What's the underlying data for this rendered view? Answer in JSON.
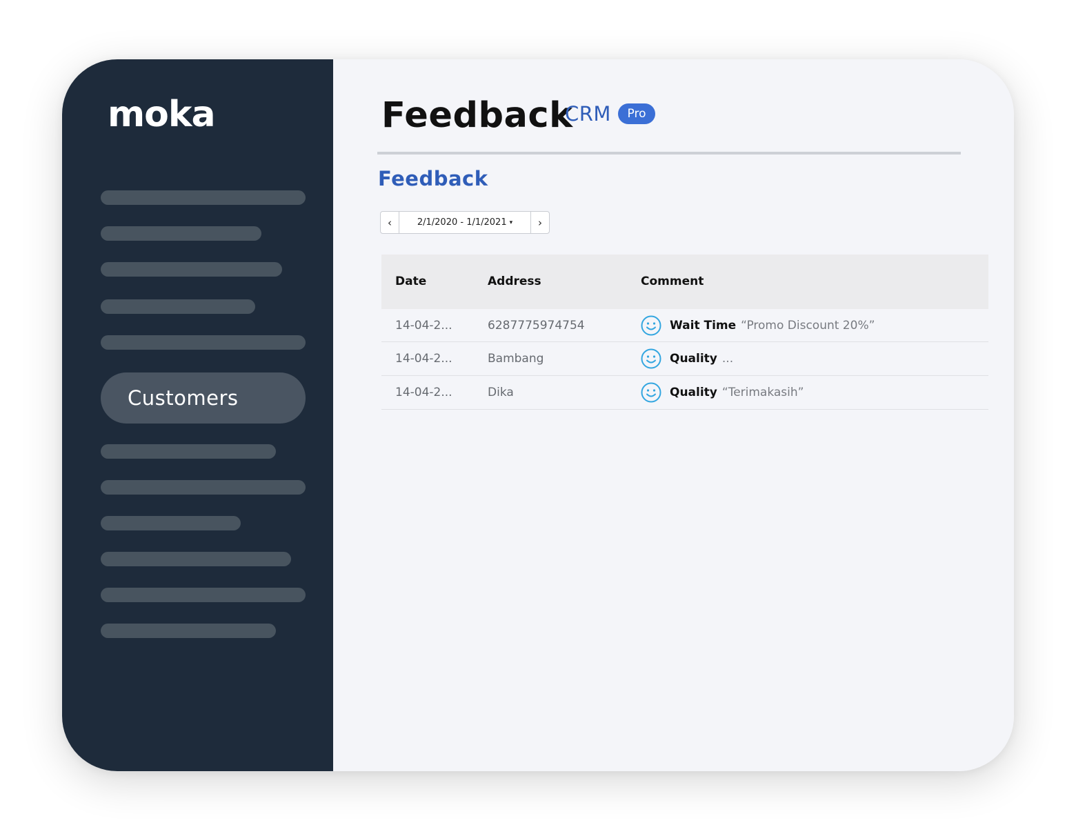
{
  "app": {
    "logo_text": "moka"
  },
  "sidebar": {
    "active_item": {
      "label": "Customers"
    }
  },
  "header": {
    "title": "Feedback",
    "product": "CRM",
    "badge": "Pro"
  },
  "section": {
    "title": "Feedback"
  },
  "date_picker": {
    "prev_icon": "chevron-left-icon",
    "next_icon": "chevron-right-icon",
    "prev_glyph": "‹",
    "next_glyph": "›",
    "range": "2/1/2020 - 1/1/2021",
    "caret_glyph": "▾"
  },
  "table": {
    "columns": [
      "Date",
      "Address",
      "Comment"
    ],
    "rows": [
      {
        "date": "14-04-2...",
        "address": "6287775974754",
        "icon": "smiley-icon",
        "type": "Wait Time",
        "text": "“Promo Discount 20%”"
      },
      {
        "date": "14-04-2...",
        "address": "Bambang",
        "icon": "smiley-icon",
        "type": "Quality",
        "text": "..."
      },
      {
        "date": "14-04-2...",
        "address": "Dika",
        "icon": "smiley-icon",
        "type": "Quality",
        "text": "“Terimakasih”"
      }
    ]
  },
  "colors": {
    "sidebar_bg": "#1e2b3b",
    "main_bg": "#f4f5f9",
    "accent_blue": "#2f5db8",
    "badge_blue": "#3b6fd6",
    "smiley_blue": "#33a6e0",
    "nav_placeholder": "#48545f"
  }
}
